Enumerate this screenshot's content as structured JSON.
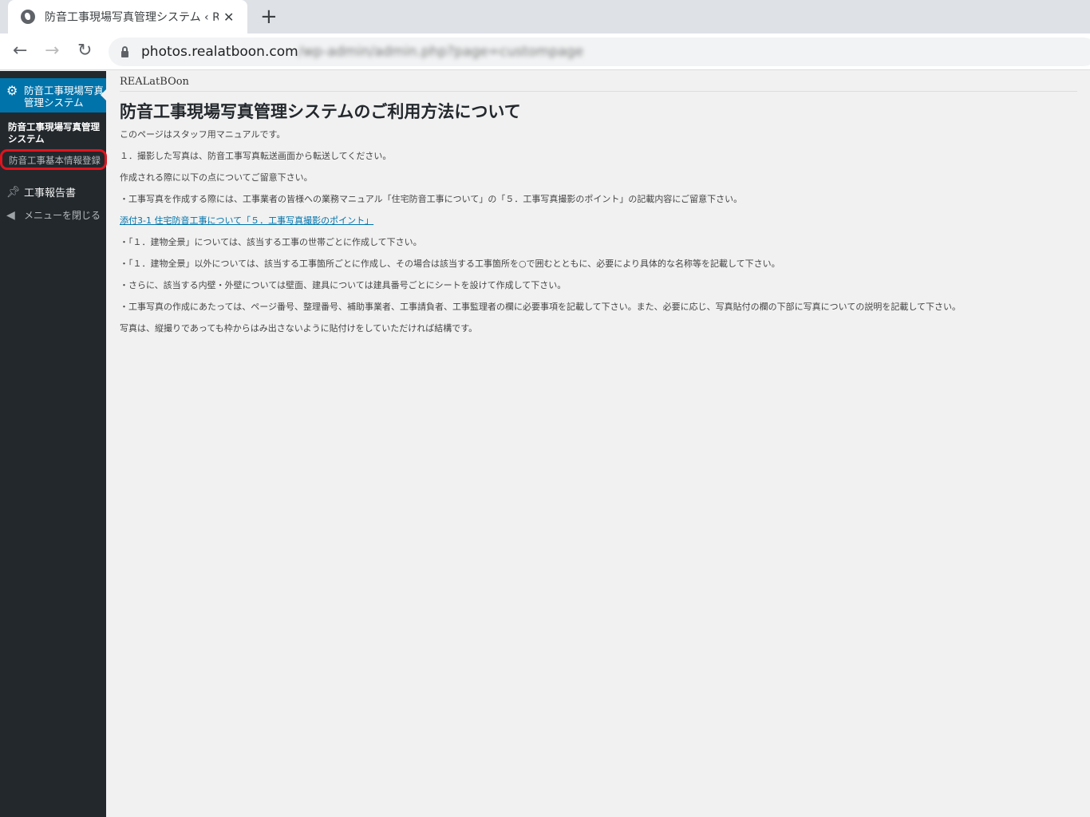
{
  "browser": {
    "tab_title": "防音工事現場写真管理システム ‹ R",
    "url_host": "photos.realatboon.com",
    "url_path_blurred": "/wp-admin/admin.php?page=custompage"
  },
  "sidebar": {
    "current": "防音工事現場写真管理システム",
    "sub_title": "防音工事現場写真管理システム",
    "sub_item": "防音工事基本情報登録",
    "report": "工事報告書",
    "collapse": "メニューを閉じる"
  },
  "main": {
    "brand": "REALatBOon",
    "title": "防音工事現場写真管理システムのご利用方法について",
    "paragraphs": [
      "このページはスタッフ用マニュアルです。",
      "１．撮影した写真は、防音工事写真転送画面から転送してください。",
      "作成される際に以下の点についてご留意下さい。",
      "・工事写真を作成する際には、工事業者の皆様への業務マニュアル「住宅防音工事について」の「５．工事写真撮影のポイント」の記載内容にご留意下さい。"
    ],
    "link": "添付3-1 住宅防音工事について「５．工事写真撮影のポイント」",
    "paragraphs2": [
      "・「１．建物全景」については、該当する工事の世帯ごとに作成して下さい。",
      "・「１．建物全景」以外については、該当する工事箇所ごとに作成し、その場合は該当する工事箇所を○で囲むとともに、必要により具体的な名称等を記載して下さい。",
      "・さらに、該当する内壁・外壁については壁面、建具については建具番号ごとにシートを設けて作成して下さい。",
      "・工事写真の作成にあたっては、ページ番号、整理番号、補助事業者、工事請負者、工事監理者の欄に必要事項を記載して下さい。また、必要に応じ、写真貼付の欄の下部に写真についての説明を記載して下さい。",
      "写真は、縦撮りであっても枠からはみ出さないように貼付けをしていただければ結構です。"
    ]
  }
}
